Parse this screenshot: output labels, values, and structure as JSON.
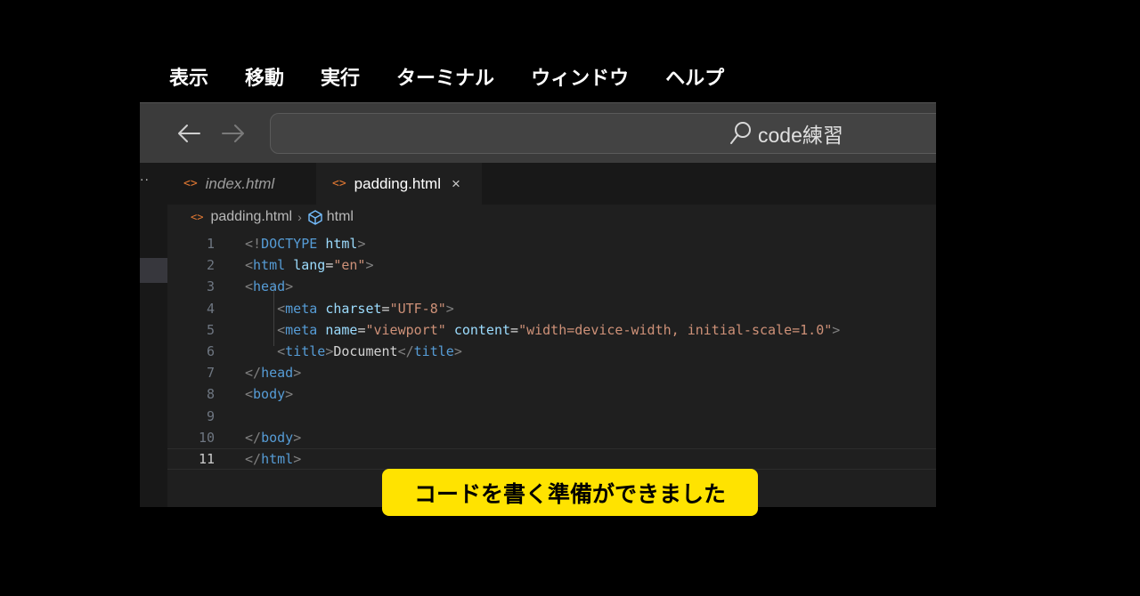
{
  "menubar": {
    "items": [
      "表示",
      "移動",
      "実行",
      "ターミナル",
      "ウィンドウ",
      "ヘルプ"
    ]
  },
  "titlebar": {
    "search_text": "code練習"
  },
  "tabs": [
    {
      "label": "index.html",
      "active": false
    },
    {
      "label": "padding.html",
      "active": true,
      "close_icon": "×"
    }
  ],
  "breadcrumb": {
    "file": "padding.html",
    "element": "html"
  },
  "editor": {
    "lines": [
      {
        "n": "1",
        "tokens": [
          [
            "p",
            "<!"
          ],
          [
            "t",
            "DOCTYPE"
          ],
          [
            "x",
            " "
          ],
          [
            "a",
            "html"
          ],
          [
            "p",
            ">"
          ]
        ]
      },
      {
        "n": "2",
        "tokens": [
          [
            "p",
            "<"
          ],
          [
            "t",
            "html"
          ],
          [
            "x",
            " "
          ],
          [
            "a",
            "lang"
          ],
          [
            "x",
            "="
          ],
          [
            "s",
            "\"en\""
          ],
          [
            "p",
            ">"
          ]
        ]
      },
      {
        "n": "3",
        "tokens": [
          [
            "p",
            "<"
          ],
          [
            "t",
            "head"
          ],
          [
            "p",
            ">"
          ]
        ]
      },
      {
        "n": "4",
        "tokens": [
          [
            "x",
            "    "
          ],
          [
            "p",
            "<"
          ],
          [
            "t",
            "meta"
          ],
          [
            "x",
            " "
          ],
          [
            "a",
            "charset"
          ],
          [
            "x",
            "="
          ],
          [
            "s",
            "\"UTF-8\""
          ],
          [
            "p",
            ">"
          ]
        ]
      },
      {
        "n": "5",
        "tokens": [
          [
            "x",
            "    "
          ],
          [
            "p",
            "<"
          ],
          [
            "t",
            "meta"
          ],
          [
            "x",
            " "
          ],
          [
            "a",
            "name"
          ],
          [
            "x",
            "="
          ],
          [
            "s",
            "\"viewport\""
          ],
          [
            "x",
            " "
          ],
          [
            "a",
            "content"
          ],
          [
            "x",
            "="
          ],
          [
            "s",
            "\"width=device-width, initial-scale=1.0\""
          ],
          [
            "p",
            ">"
          ]
        ]
      },
      {
        "n": "6",
        "tokens": [
          [
            "x",
            "    "
          ],
          [
            "p",
            "<"
          ],
          [
            "t",
            "title"
          ],
          [
            "p",
            ">"
          ],
          [
            "x",
            "Document"
          ],
          [
            "p",
            "</"
          ],
          [
            "t",
            "title"
          ],
          [
            "p",
            ">"
          ]
        ]
      },
      {
        "n": "7",
        "tokens": [
          [
            "p",
            "</"
          ],
          [
            "t",
            "head"
          ],
          [
            "p",
            ">"
          ]
        ]
      },
      {
        "n": "8",
        "tokens": [
          [
            "p",
            "<"
          ],
          [
            "t",
            "body"
          ],
          [
            "p",
            ">"
          ]
        ]
      },
      {
        "n": "9",
        "tokens": []
      },
      {
        "n": "10",
        "tokens": [
          [
            "p",
            "</"
          ],
          [
            "t",
            "body"
          ],
          [
            "p",
            ">"
          ]
        ]
      },
      {
        "n": "11",
        "tokens": [
          [
            "p",
            "</"
          ],
          [
            "t",
            "html"
          ],
          [
            "p",
            ">"
          ]
        ],
        "current": true
      }
    ]
  },
  "caption": "コードを書く準備ができました",
  "colors": {
    "caption_bg": "#ffe300",
    "tag": "#569cd6",
    "attr": "#9cdcfe",
    "string": "#ce9178",
    "html_icon": "#e37933"
  }
}
